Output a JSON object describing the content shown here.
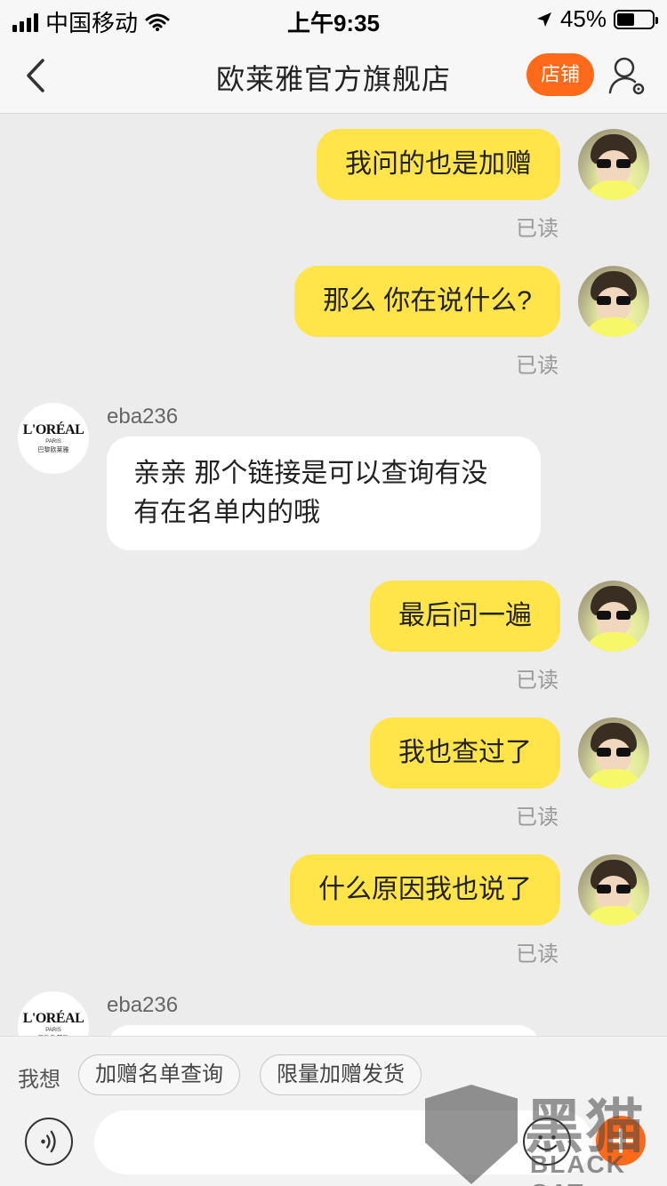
{
  "status_bar": {
    "carrier": "中国移动",
    "time": "上午9:35",
    "battery_percent": "45%"
  },
  "nav": {
    "title": "欧莱雅官方旗舰店",
    "store_button": "店铺"
  },
  "store_avatar": {
    "brand": "L'ORÉAL",
    "city": "PARIS",
    "cn": "巴黎欧莱雅"
  },
  "messages": [
    {
      "from": "me",
      "text": "我问的也是加赠",
      "status": "已读"
    },
    {
      "from": "me",
      "text": "那么 你在说什么?",
      "status": "已读"
    },
    {
      "from": "store",
      "sender": "eba236",
      "text": "亲亲  那个链接是可以查询有没有在名单内的哦"
    },
    {
      "from": "me",
      "text": "最后问一遍",
      "status": "已读"
    },
    {
      "from": "me",
      "text": "我也查过了",
      "status": "已读"
    },
    {
      "from": "me",
      "text": "什么原因我也说了",
      "status": "已读"
    },
    {
      "from": "store",
      "sender": "eba236",
      "text": ""
    }
  ],
  "quick_replies": {
    "label": "我想",
    "items": [
      "加赠名单查询",
      "限量加赠发货"
    ]
  },
  "input": {
    "placeholder": ""
  },
  "watermark": {
    "title": "黑猫",
    "subtitle": "BLACK CAT"
  },
  "colors": {
    "accent": "#ff6a1a",
    "my_bubble": "#ffe44a",
    "their_bubble": "#ffffff",
    "background": "#ececec"
  }
}
